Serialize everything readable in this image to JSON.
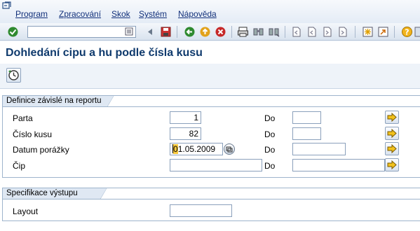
{
  "menu": {
    "items": [
      {
        "label": "Program"
      },
      {
        "label": "Zpracování"
      },
      {
        "label": "Skok"
      },
      {
        "label": "Systém"
      },
      {
        "label": "Nápověda"
      }
    ]
  },
  "toolbar": {
    "command_value": "",
    "icons": [
      "enter-icon",
      "save-icon",
      "back-icon",
      "exit-icon",
      "cancel-icon",
      "print-icon",
      "find-icon",
      "find-next-icon",
      "first-page-icon",
      "previous-page-icon",
      "next-page-icon",
      "last-page-icon",
      "new-session-icon",
      "shortcut-icon",
      "help-icon"
    ]
  },
  "title": "Dohledání cipu a hu podle čísla kusu",
  "app_toolbar": {
    "execute_icon": "execute-clock-icon"
  },
  "selection_group": {
    "title": "Definice závislé na reportu",
    "rows": [
      {
        "label": "Parta",
        "from": "1",
        "to_label": "Do",
        "to": ""
      },
      {
        "label": "Číslo kusu",
        "from": "82",
        "to_label": "Do",
        "to": ""
      },
      {
        "label": "Datum porážky",
        "from_hl": "0",
        "from_rest": "1.05.2009",
        "to_label": "Do",
        "to": ""
      },
      {
        "label": "Čip",
        "from": "",
        "to_label": "Do",
        "to": ""
      }
    ]
  },
  "output_group": {
    "title": "Specifikace výstupu",
    "layout_label": "Layout",
    "layout_value": ""
  },
  "colors": {
    "title": "#0f3a6d",
    "menu_text": "#12307a",
    "highlight": "#f7c93e"
  }
}
